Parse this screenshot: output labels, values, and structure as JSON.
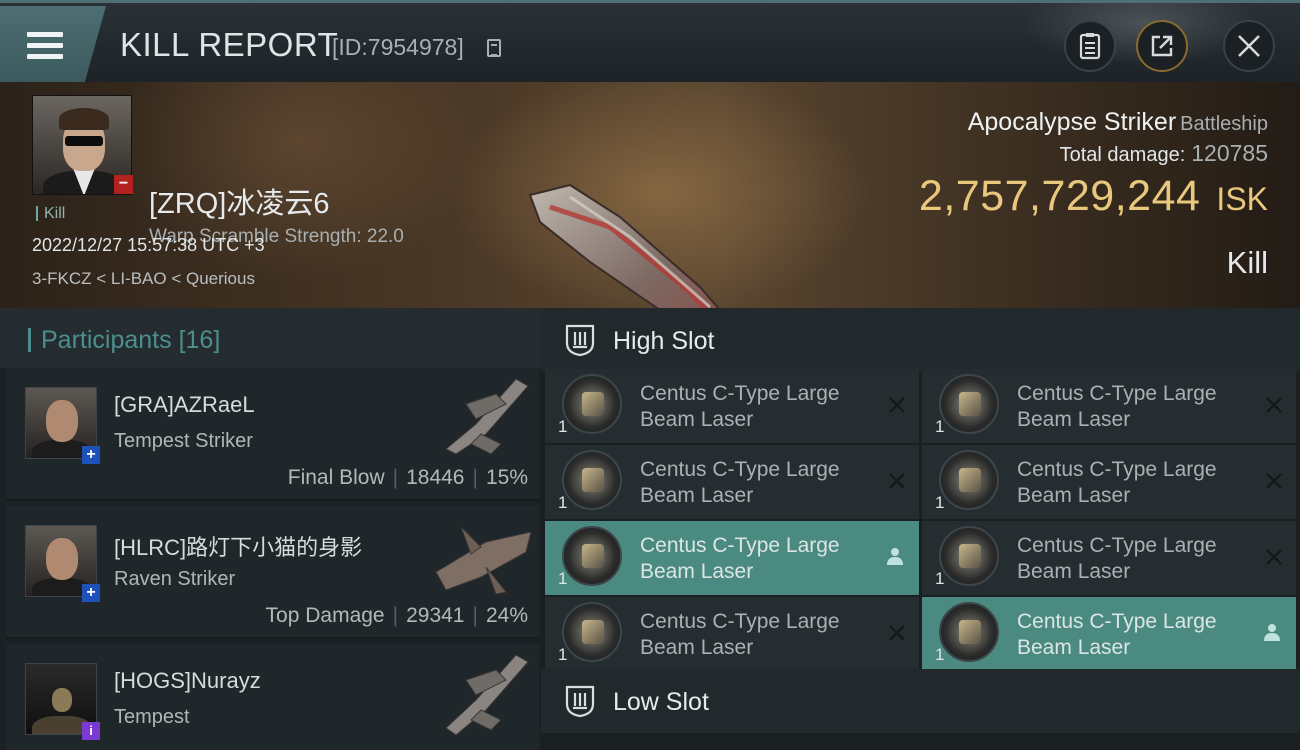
{
  "header": {
    "title": "KILL REPORT",
    "report_id": "[ID:7954978]",
    "icons": [
      "menu-icon",
      "copy-icon",
      "clipboard-icon",
      "share-icon",
      "close-icon"
    ]
  },
  "victim": {
    "name": "[ZRQ]冰凌云6",
    "warp_scramble": "Warp Scramble Strength: 22.0",
    "tag": "Kill",
    "timestamp": "2022/12/27 15:57:38 UTC +3",
    "location": "3-FKCZ < LI-BAO < Querious",
    "badge": "−"
  },
  "ship": {
    "name": "Apocalypse Striker",
    "class": "Battleship",
    "total_damage_label": "Total damage:",
    "total_damage": "120785",
    "isk_value": "2,757,729,244",
    "isk_unit": "ISK",
    "result": "Kill"
  },
  "participants": {
    "title": "Participants",
    "count": "[16]",
    "items": [
      {
        "name": "[GRA]AZRaeL",
        "ship": "Tempest Striker",
        "label": "Final Blow",
        "damage": "18446",
        "percent": "15%",
        "badge": "+"
      },
      {
        "name": "[HLRC]路灯下小猫的身影",
        "ship": "Raven Striker",
        "label": "Top Damage",
        "damage": "29341",
        "percent": "24%",
        "badge": "+"
      },
      {
        "name": "[HOGS]Nurayz",
        "ship": "Tempest",
        "badge": "i"
      }
    ]
  },
  "slots": {
    "high": {
      "title": "High Slot",
      "modules": [
        {
          "line1": "Centus C-Type Large",
          "line2": "Beam Laser",
          "qty": "1",
          "status": "destroyed"
        },
        {
          "line1": "Centus C-Type Large",
          "line2": "Beam Laser",
          "qty": "1",
          "status": "destroyed"
        },
        {
          "line1": "Centus C-Type Large",
          "line2": "Beam Laser",
          "qty": "1",
          "status": "destroyed"
        },
        {
          "line1": "Centus C-Type Large",
          "line2": "Beam Laser",
          "qty": "1",
          "status": "destroyed"
        },
        {
          "line1": "Centus C-Type Large",
          "line2": "Beam Laser",
          "qty": "1",
          "status": "dropped"
        },
        {
          "line1": "Centus C-Type Large",
          "line2": "Beam Laser",
          "qty": "1",
          "status": "destroyed"
        },
        {
          "line1": "Centus C-Type Large",
          "line2": "Beam Laser",
          "qty": "1",
          "status": "destroyed"
        },
        {
          "line1": "Centus C-Type Large",
          "line2": "Beam Laser",
          "qty": "1",
          "status": "dropped"
        }
      ]
    },
    "low": {
      "title": "Low Slot"
    }
  },
  "colors": {
    "accent": "#4c8f8e",
    "isk": "#e9c87e",
    "dropped": "#4a8a80",
    "badge_red": "#b2231f",
    "badge_blue": "#1f52b8",
    "badge_purple": "#7a3ad1"
  }
}
